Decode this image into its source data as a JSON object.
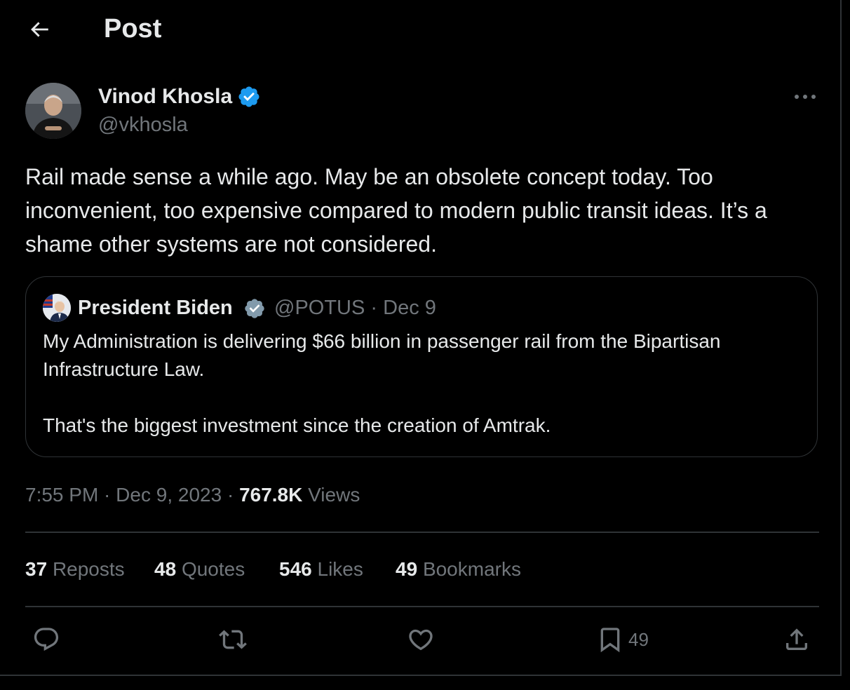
{
  "header": {
    "title": "Post"
  },
  "post": {
    "author_name": "Vinod Khosla",
    "author_handle": "@vkhosla",
    "text": "Rail made sense a while ago. May be an obsolete concept today. Too inconvenient, too expensive compared to modern public transit ideas. It’s a shame other systems are not considered.",
    "time": "7:55 PM",
    "date": "Dec 9, 2023",
    "views_count": "767.8K",
    "views_label": "Views"
  },
  "quote": {
    "author_name": "President Biden",
    "handle": "@POTUS",
    "date": "Dec 9",
    "paragraph1": "My Administration is delivering $66 billion in passenger rail from the Bipartisan Infrastructure Law.",
    "paragraph2": "That's the biggest investment since the creation of Amtrak."
  },
  "stats": {
    "reposts": {
      "count": "37",
      "label": "Reposts"
    },
    "quotes": {
      "count": "48",
      "label": "Quotes"
    },
    "likes": {
      "count": "546",
      "label": "Likes"
    },
    "bookmarks": {
      "count": "49",
      "label": "Bookmarks"
    }
  },
  "actions": {
    "reply_icon": "reply-icon",
    "repost_icon": "repost-icon",
    "like_icon": "heart-icon",
    "bookmark_icon": "bookmark-icon",
    "bookmark_count": "49",
    "share_icon": "share-icon"
  },
  "colors": {
    "background": "#000000",
    "text": "#e7e9ea",
    "muted": "#71767b",
    "border": "#2f3336",
    "verified_blue": "#1d9bf0",
    "verified_gray": "#829aab"
  }
}
